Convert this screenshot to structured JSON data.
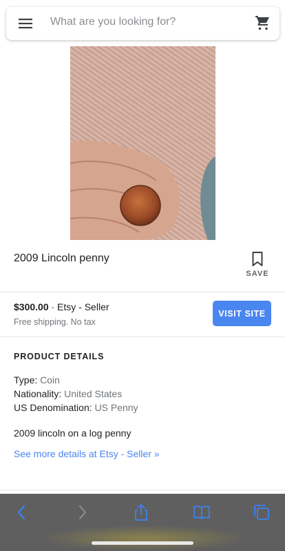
{
  "search": {
    "placeholder": "What are you looking for?"
  },
  "product": {
    "title": "2009 Lincoln penny",
    "save_label": "SAVE",
    "price": "$300.00",
    "seller": "· Etsy - Seller",
    "shipping": "Free shipping. No tax",
    "visit_label": "VISIT SITE"
  },
  "details": {
    "heading": "PRODUCT DETAILS",
    "specs": [
      {
        "label": "Type:",
        "value": "Coin"
      },
      {
        "label": "Nationality:",
        "value": "United States"
      },
      {
        "label": "US Denomination:",
        "value": "US Penny"
      }
    ],
    "description": "2009 lincoln on a log penny",
    "more_link": "See more details at Etsy - Seller »"
  },
  "toolbar": {
    "icons": [
      "back-icon",
      "forward-icon",
      "share-icon",
      "bookmarks-icon",
      "tabs-icon"
    ]
  },
  "colors": {
    "accent": "#4a86f0",
    "toolbar": "#5f5f5f",
    "toolbar_icon": "#3b82f6"
  }
}
